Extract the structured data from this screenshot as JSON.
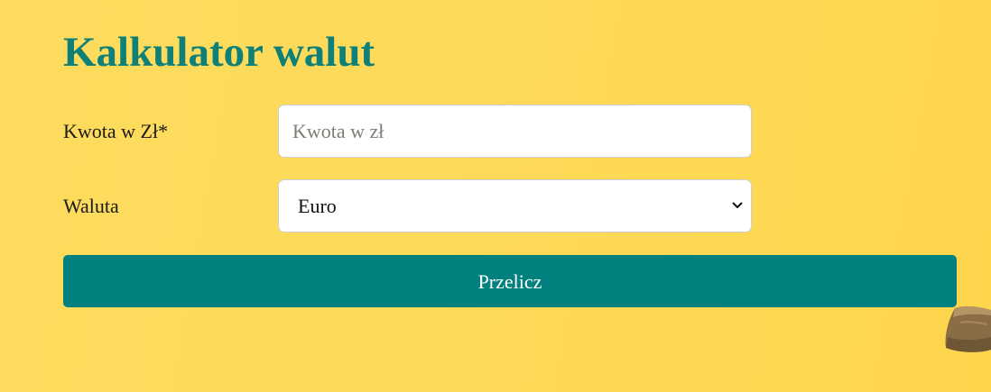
{
  "page": {
    "title": "Kalkulator walut"
  },
  "form": {
    "amount": {
      "label": "Kwota w Zł*",
      "value": "",
      "placeholder": "Kwota w zł"
    },
    "currency": {
      "label": "Waluta",
      "selected": "Euro"
    },
    "submit_label": "Przelicz"
  },
  "colors": {
    "background": "#fdd957",
    "title": "#0f8077",
    "button": "#01807d",
    "button_text": "#ffffff"
  },
  "icons": {
    "select_arrow": "chevron-down-icon",
    "decoration": "stone-decoration"
  }
}
